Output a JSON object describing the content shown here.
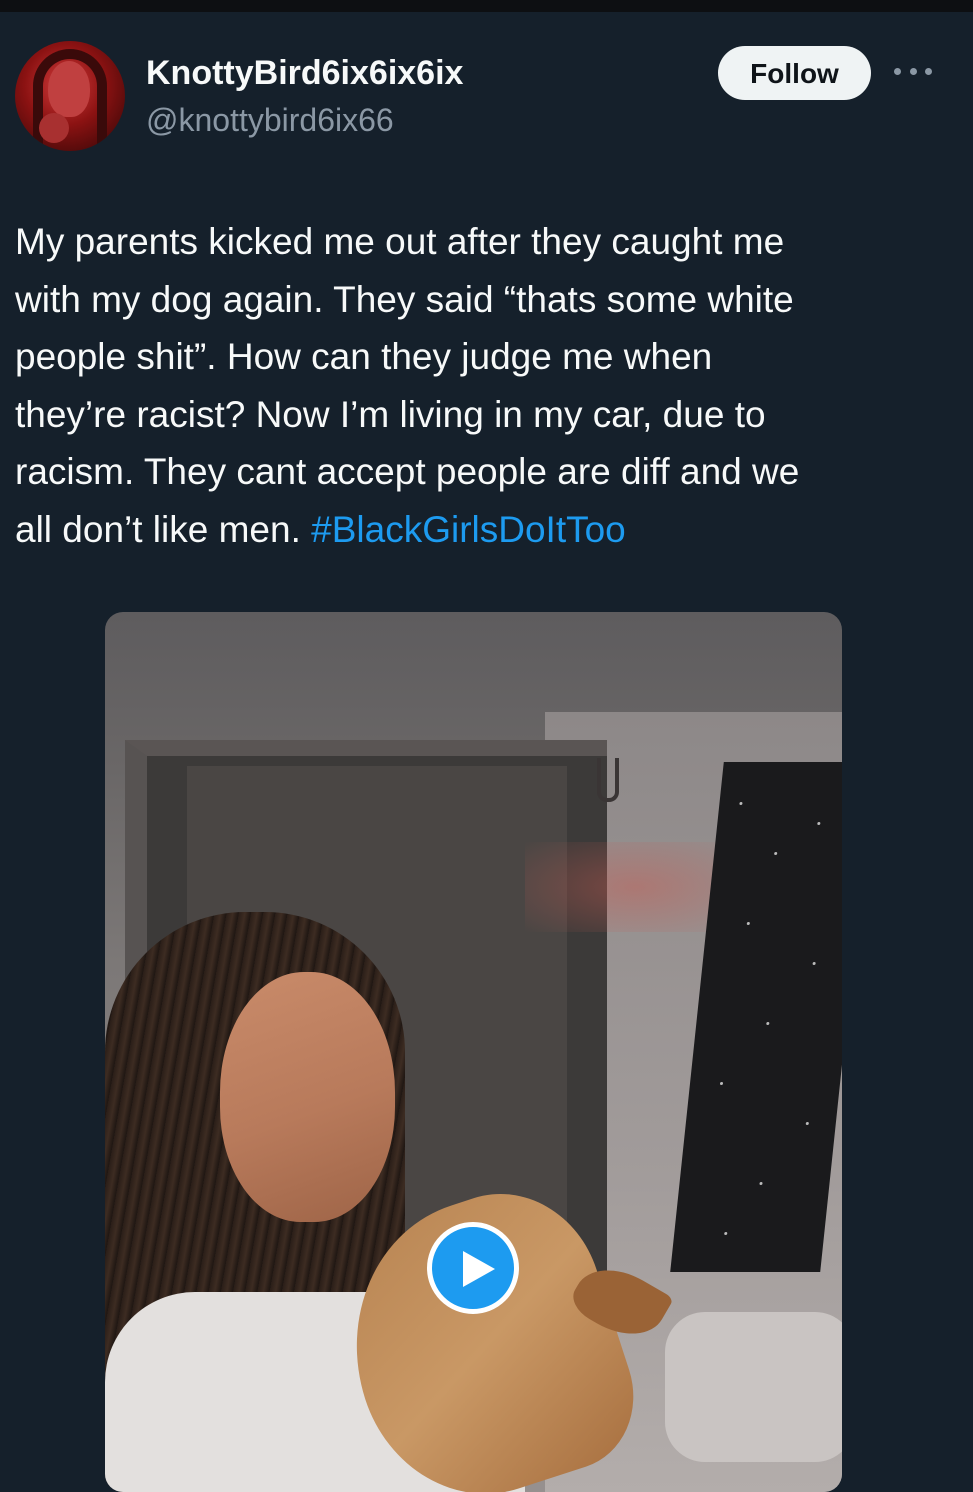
{
  "tweet": {
    "display_name": "KnottyBird6ix6ix6ix",
    "handle": "@knottybird6ix66",
    "follow_label": "Follow",
    "more_icon": "more-horizontal-icon",
    "text_lines": [
      "My parents kicked me out after they caught me",
      "with my dog again. They said “thats some white",
      "people shit”. How can they judge me when",
      "they’re racist? Now I’m living in my car, due to",
      "racism. They cant accept people are diff and we",
      "all don’t like men."
    ],
    "hashtag": "#BlackGirlsDoItToo"
  },
  "media": {
    "type": "video",
    "play_icon": "play-icon"
  },
  "colors": {
    "background": "#15202b",
    "text": "#f7f9f9",
    "secondary_text": "#8b98a5",
    "accent": "#1d9bf0",
    "follow_button_bg": "#eff3f4"
  }
}
